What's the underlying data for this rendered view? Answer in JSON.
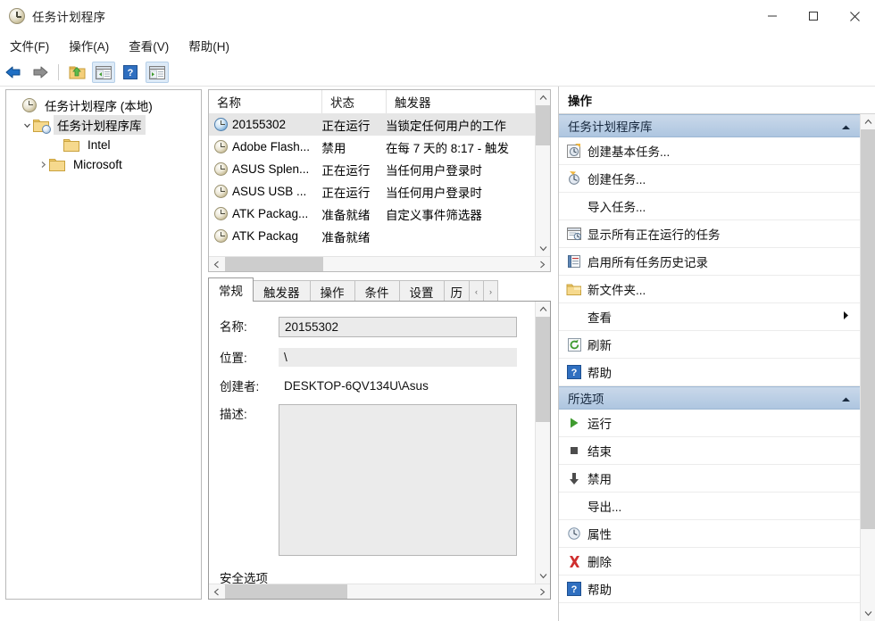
{
  "window": {
    "title": "任务计划程序",
    "icon": "clock-icon",
    "controls": {
      "minimize": "minimize-button",
      "maximize": "maximize-button",
      "close": "close-button"
    }
  },
  "menubar": {
    "items": [
      {
        "label": "文件(F)",
        "name": "menu-file"
      },
      {
        "label": "操作(A)",
        "name": "menu-action"
      },
      {
        "label": "查看(V)",
        "name": "menu-view"
      },
      {
        "label": "帮助(H)",
        "name": "menu-help"
      }
    ]
  },
  "toolbar": {
    "buttons": [
      {
        "name": "back-button",
        "icon": "back-arrow-icon",
        "pressed": false
      },
      {
        "name": "forward-button",
        "icon": "forward-arrow-icon",
        "pressed": false
      },
      {
        "name": "up-one-level-button",
        "icon": "folder-up-icon",
        "pressed": false
      },
      {
        "name": "show-console-tree-button",
        "icon": "console-tree-icon",
        "pressed": true
      },
      {
        "name": "help-button",
        "icon": "question-mark-icon",
        "pressed": false
      },
      {
        "name": "show-action-pane-button",
        "icon": "action-pane-icon",
        "pressed": true
      }
    ]
  },
  "tree": {
    "nodes": [
      {
        "label": "任务计划程序 (本地)",
        "icon": "clock-icon",
        "indent": 0,
        "twisty": "none",
        "selected": false
      },
      {
        "label": "任务计划程序库",
        "icon": "library-folder-icon",
        "indent": 1,
        "twisty": "expanded",
        "selected": true
      },
      {
        "label": "Intel",
        "icon": "folder-icon",
        "indent": 2,
        "twisty": "none",
        "selected": false
      },
      {
        "label": "Microsoft",
        "icon": "folder-icon",
        "indent": 2,
        "twisty": "collapsed",
        "selected": false
      }
    ]
  },
  "task_list": {
    "columns": [
      "名称",
      "状态",
      "触发器"
    ],
    "rows": [
      {
        "name": "20155302",
        "status": "正在运行",
        "trigger": "当锁定任何用户的工作",
        "selected": true,
        "icon": "clock-icon-active"
      },
      {
        "name": "Adobe Flash...",
        "status": "禁用",
        "trigger": "在每 7 天的 8:17 - 触发",
        "selected": false,
        "icon": "clock-icon"
      },
      {
        "name": "ASUS Splen...",
        "status": "正在运行",
        "trigger": "当任何用户登录时",
        "selected": false,
        "icon": "clock-icon"
      },
      {
        "name": "ASUS USB ...",
        "status": "正在运行",
        "trigger": "当任何用户登录时",
        "selected": false,
        "icon": "clock-icon"
      },
      {
        "name": "ATK Packag...",
        "status": "准备就绪",
        "trigger": "自定义事件筛选器",
        "selected": false,
        "icon": "clock-icon"
      },
      {
        "name": "ATK Packag",
        "status": "准备就绪",
        "trigger": "",
        "selected": false,
        "icon": "clock-icon"
      }
    ]
  },
  "details": {
    "tabs": [
      {
        "label": "常规",
        "active": true,
        "name": "tab-general"
      },
      {
        "label": "触发器",
        "active": false,
        "name": "tab-triggers"
      },
      {
        "label": "操作",
        "active": false,
        "name": "tab-actions"
      },
      {
        "label": "条件",
        "active": false,
        "name": "tab-conditions"
      },
      {
        "label": "设置",
        "active": false,
        "name": "tab-settings"
      },
      {
        "label": "历",
        "active": false,
        "name": "tab-history"
      }
    ],
    "tab_scroll_left": "‹",
    "tab_scroll_right": "›",
    "fields": {
      "name_label": "名称:",
      "name_value": "20155302",
      "location_label": "位置:",
      "location_value": "\\",
      "author_label": "创建者:",
      "author_value": "DESKTOP-6QV134U\\Asus",
      "description_label": "描述:",
      "description_value": "",
      "security_options_label": "安全选项"
    }
  },
  "actions_pane": {
    "title": "操作",
    "groups": [
      {
        "header": "任务计划程序库",
        "name": "group-task-scheduler-library",
        "collapse_icon": "chevron-up-icon",
        "items": [
          {
            "label": "创建基本任务...",
            "icon": "create-basic-task-icon",
            "name": "action-create-basic-task",
            "submenu": false
          },
          {
            "label": "创建任务...",
            "icon": "create-task-icon",
            "name": "action-create-task",
            "submenu": false
          },
          {
            "label": "导入任务...",
            "icon": "none",
            "name": "action-import-task",
            "submenu": false
          },
          {
            "label": "显示所有正在运行的任务",
            "icon": "running-tasks-icon",
            "name": "action-display-running-tasks",
            "submenu": false
          },
          {
            "label": "启用所有任务历史记录",
            "icon": "task-history-icon",
            "name": "action-enable-all-task-history",
            "submenu": false
          },
          {
            "label": "新文件夹...",
            "icon": "new-folder-icon",
            "name": "action-new-folder",
            "submenu": false
          },
          {
            "label": "查看",
            "icon": "none",
            "name": "action-view",
            "submenu": true
          },
          {
            "label": "刷新",
            "icon": "refresh-icon",
            "name": "action-refresh",
            "submenu": false
          },
          {
            "label": "帮助",
            "icon": "question-mark-icon",
            "name": "action-help",
            "submenu": false
          }
        ]
      },
      {
        "header": "所选项",
        "name": "group-selected-item",
        "collapse_icon": "chevron-up-icon",
        "items": [
          {
            "label": "运行",
            "icon": "run-icon",
            "name": "action-run",
            "submenu": false
          },
          {
            "label": "结束",
            "icon": "end-icon",
            "name": "action-end",
            "submenu": false
          },
          {
            "label": "禁用",
            "icon": "disable-icon",
            "name": "action-disable",
            "submenu": false
          },
          {
            "label": "导出...",
            "icon": "none",
            "name": "action-export",
            "submenu": false
          },
          {
            "label": "属性",
            "icon": "properties-icon",
            "name": "action-properties",
            "submenu": false
          },
          {
            "label": "删除",
            "icon": "delete-icon",
            "name": "action-delete",
            "submenu": false
          },
          {
            "label": "帮助",
            "icon": "question-mark-icon",
            "name": "action-help-selected",
            "submenu": false
          }
        ]
      }
    ]
  },
  "colors": {
    "group_header_top": "#c9d8ea",
    "group_header_bottom": "#aec6e0",
    "selection": "#e6e6e6",
    "toolbar_pressed": "#ddeaf7",
    "scrollbar_thumb": "#cdcdcd"
  }
}
